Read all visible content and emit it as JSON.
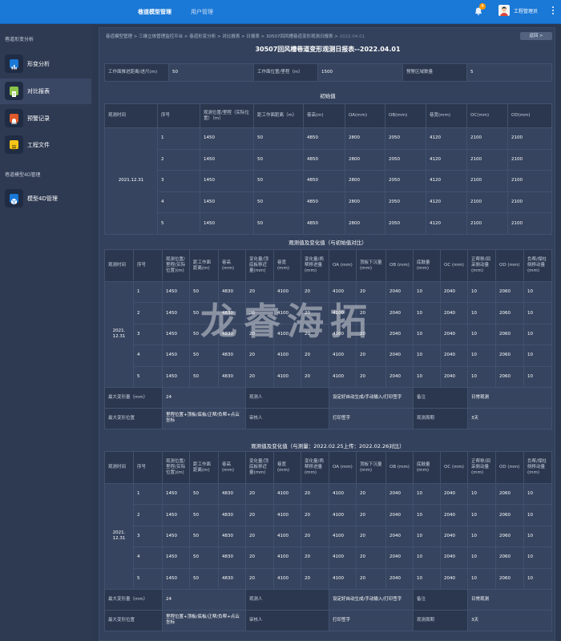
{
  "topbar": {
    "tabs": [
      "巷道模型管理",
      "用户管理"
    ],
    "notification_count": "4",
    "username": "工程管理员"
  },
  "sidebar": {
    "group1": "巷道形变分析",
    "items": [
      {
        "label": "形变分析",
        "icon": "chart-icon",
        "color": "#1a78d6"
      },
      {
        "label": "对比报表",
        "icon": "report-icon",
        "color": "#8bc34a"
      },
      {
        "label": "预警记录",
        "icon": "alarm-icon",
        "color": "#e0592a"
      },
      {
        "label": "工程文件",
        "icon": "file-icon",
        "color": "#f5c518"
      }
    ],
    "group2": "巷道模型4D管理",
    "items2": [
      {
        "label": "模型4D管理",
        "icon": "cube-icon",
        "color": "#1a78d6"
      }
    ]
  },
  "breadcrumb": {
    "path": "巷道模型管理 > 三维立体管理监控平台 > 巷道形变分析 > 对比报表 > 日报表 > 30507回风槽巷道变形观测日报表",
    "current": "2022.04.01"
  },
  "back_label": "返回 >",
  "title": "30507回风槽巷道变形观测日报表--2022.04.01",
  "info": {
    "l1": "工作面推进距离/进尺(m)",
    "v1": "50",
    "l2": "工作面位置/里程（m）",
    "v2": "1500",
    "l3": "预警区域数量",
    "v3": "5"
  },
  "section1": {
    "title": "初始值",
    "headers": [
      "观测时间",
      "序号",
      "观测位置/里程（实际位置）（m）",
      "距工作面距离（m）",
      "巷高(m)",
      "OA(mm)",
      "OB(mm)",
      "巷宽(mm)",
      "OC(mm)",
      "OD(mm)"
    ],
    "date": "2021.12.31",
    "rows": [
      [
        "1",
        "1450",
        "50",
        "4850",
        "2800",
        "2050",
        "4120",
        "2100",
        "2100"
      ],
      [
        "2",
        "1450",
        "50",
        "4850",
        "2800",
        "2050",
        "4120",
        "2100",
        "2100"
      ],
      [
        "3",
        "1450",
        "50",
        "4850",
        "2800",
        "2050",
        "4120",
        "2100",
        "2100"
      ],
      [
        "4",
        "1450",
        "50",
        "4850",
        "2800",
        "2050",
        "4120",
        "2100",
        "2100"
      ],
      [
        "5",
        "1450",
        "50",
        "4850",
        "2800",
        "2050",
        "4120",
        "2100",
        "2100"
      ]
    ]
  },
  "section2": {
    "title": "观测值及变化值（与初始值对比）",
    "headers": [
      "观测时间",
      "序号",
      "观测位置/里程(实际位置)(m)",
      "距工作面距离(m)",
      "巷高(mm)",
      "变化量/顶底板移近量(mm)",
      "巷宽(mm)",
      "变化量/两帮移进量(mm)",
      "OA (mm)",
      "顶板下沉量(mm)",
      "OB (mm)",
      "底鼓量(mm)",
      "OC (mm)",
      "正帮移/回采侧动量 (mm)",
      "OD (mm)",
      "负帮/煤柱侧移动量(mm)"
    ],
    "date": "2021.\n12.31",
    "rows": [
      [
        "1",
        "1450",
        "50",
        "4830",
        "20",
        "4100",
        "20",
        "4100",
        "20",
        "2040",
        "10",
        "2040",
        "10",
        "2060",
        "10"
      ],
      [
        "2",
        "1450",
        "50",
        "4830",
        "20",
        "4100",
        "20",
        "4100",
        "20",
        "2040",
        "10",
        "2040",
        "10",
        "2060",
        "10"
      ],
      [
        "3",
        "1450",
        "50",
        "4830",
        "20",
        "4100",
        "20",
        "4100",
        "20",
        "2040",
        "10",
        "2040",
        "10",
        "2060",
        "10"
      ],
      [
        "4",
        "1450",
        "50",
        "4830",
        "20",
        "4100",
        "20",
        "4100",
        "20",
        "2040",
        "10",
        "2040",
        "10",
        "2060",
        "10"
      ],
      [
        "5",
        "1450",
        "50",
        "4830",
        "20",
        "4100",
        "20",
        "4100",
        "20",
        "2040",
        "10",
        "2040",
        "10",
        "2060",
        "10"
      ]
    ],
    "footer": {
      "max_label": "最大变形量（mm）",
      "max_value": "24",
      "observer_label": "观测人",
      "observer_value": "设定好自动生成/手动输入/打印签字",
      "remark_label": "备注",
      "remark_value": "日常观测",
      "pos_label": "最大变形位置",
      "pos_value": "里程位置+顶板/底板/正帮/负帮+点云坐标",
      "reviewer_label": "审核人",
      "reviewer_value": "打印签字",
      "period_label": "观测周期",
      "period_value": "3天"
    }
  },
  "section3": {
    "title": "观测值及变化值（与测量：2022.02.25上传：2022.02.26对比）",
    "headers": [
      "观测时间",
      "序号",
      "观测位置/里程(实际位置)(m)",
      "距工作面距离(m)",
      "巷高(mm)",
      "变化量/顶底板移近量(mm)",
      "巷宽(mm)",
      "变化量/两帮移进量(mm)",
      "OA (mm)",
      "顶板下沉量(mm)",
      "OB (mm)",
      "底鼓量(mm)",
      "OC (mm)",
      "正帮移/回采侧动量 (mm)",
      "OD (mm)",
      "负帮/煤柱侧移动量(mm)"
    ],
    "date": "2021.\n12.31",
    "rows": [
      [
        "1",
        "1450",
        "50",
        "4830",
        "20",
        "4100",
        "20",
        "4100",
        "20",
        "2040",
        "10",
        "2040",
        "10",
        "2060",
        "10"
      ],
      [
        "2",
        "1450",
        "50",
        "4830",
        "20",
        "4100",
        "20",
        "4100",
        "20",
        "2040",
        "10",
        "2040",
        "10",
        "2060",
        "10"
      ],
      [
        "3",
        "1450",
        "50",
        "4830",
        "20",
        "4100",
        "20",
        "4100",
        "20",
        "2040",
        "10",
        "2040",
        "10",
        "2060",
        "10"
      ],
      [
        "4",
        "1450",
        "50",
        "4830",
        "20",
        "4100",
        "20",
        "4100",
        "20",
        "2040",
        "10",
        "2040",
        "10",
        "2060",
        "10"
      ],
      [
        "5",
        "1450",
        "50",
        "4830",
        "20",
        "4100",
        "20",
        "4100",
        "20",
        "2040",
        "10",
        "2040",
        "10",
        "2060",
        "10"
      ]
    ],
    "footer": {
      "max_label": "最大变形量（mm）",
      "max_value": "24",
      "observer_label": "观测人",
      "observer_value": "设定好自动生成/手动输入/打印签字",
      "remark_label": "备注",
      "remark_value": "日常观测",
      "pos_label": "最大变形位置",
      "pos_value": "里程位置+顶板/底板/正帮/负帮+点云坐标",
      "reviewer_label": "审核人",
      "reviewer_value": "打印签字",
      "period_label": "观测周期",
      "period_value": "3天"
    }
  },
  "watermark": "龙睿海拓"
}
